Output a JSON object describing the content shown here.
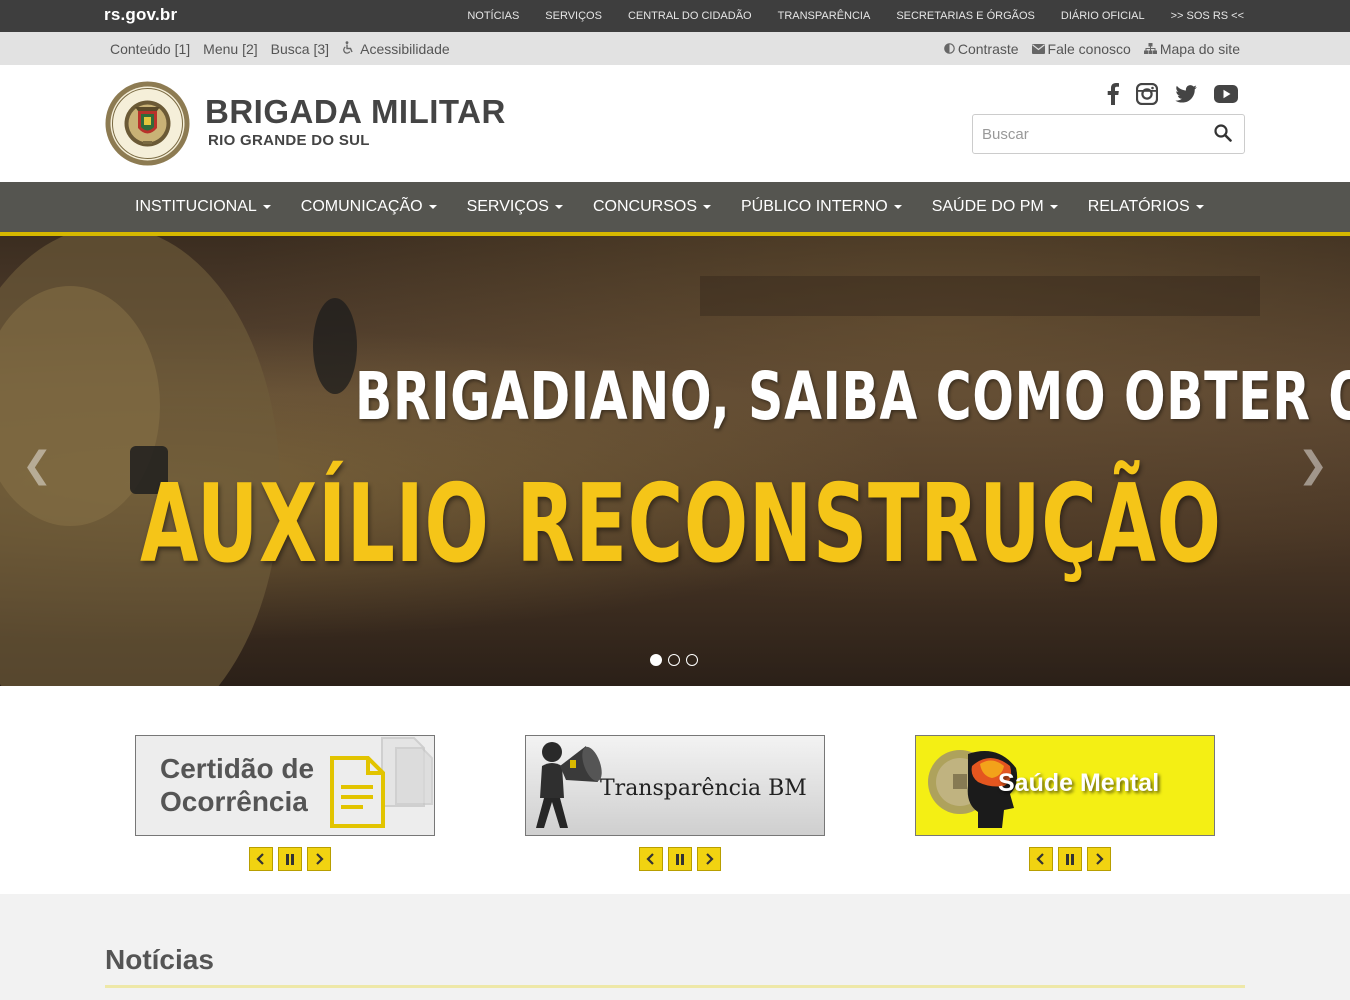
{
  "gov_bar": {
    "brand": "rs.gov.br",
    "links": [
      "NOTÍCIAS",
      "SERVIÇOS",
      "CENTRAL DO CIDADÃO",
      "TRANSPARÊNCIA",
      "SECRETARIAS E ÓRGÃOS",
      "DIÁRIO OFICIAL",
      ">> SOS RS <<"
    ]
  },
  "accessibility_bar": {
    "left": [
      "Conteúdo [1]",
      "Menu [2]",
      "Busca [3]",
      "Acessibilidade"
    ],
    "right": [
      "Contraste",
      "Fale conosco",
      "Mapa do site"
    ]
  },
  "header": {
    "title": "BRIGADA MILITAR",
    "subtitle": "RIO GRANDE DO SUL",
    "social_icons": [
      "facebook-icon",
      "instagram-icon",
      "twitter-icon",
      "youtube-icon"
    ],
    "search": {
      "placeholder": "Buscar"
    }
  },
  "main_nav": [
    "INSTITUCIONAL",
    "COMUNICAÇÃO",
    "SERVIÇOS",
    "CONCURSOS",
    "PÚBLICO INTERNO",
    "SAÚDE DO PM",
    "RELATÓRIOS"
  ],
  "carousel": {
    "line1": "BRIGADIANO, SAIBA COMO OBTER O",
    "line2": "AUXÍLIO RECONSTRUÇÃO",
    "slide_count": 3,
    "active_index": 0
  },
  "banners": [
    {
      "line1": "Certidão de",
      "line2": "Ocorrência"
    },
    {
      "text": "Transparência BM"
    },
    {
      "text": "Saúde Mental"
    }
  ],
  "news": {
    "title": "Notícias"
  },
  "colors": {
    "gov_bar": "#3e3e3e",
    "nav_bg": "#555550",
    "accent_yellow": "#f1d311",
    "headline_yellow": "#f5c518"
  }
}
